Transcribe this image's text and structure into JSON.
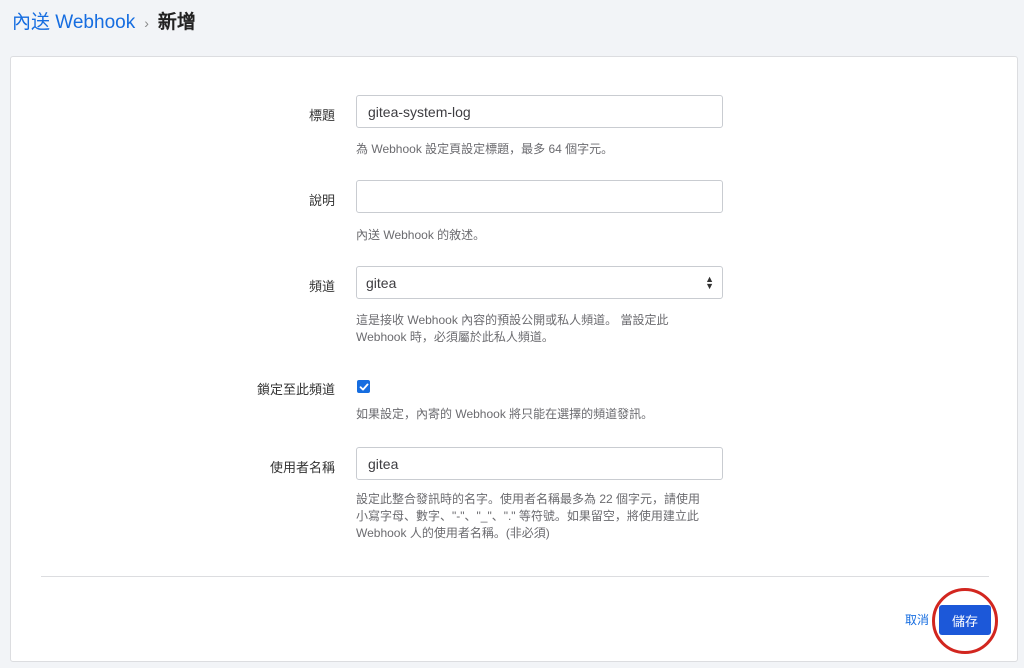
{
  "breadcrumb": {
    "parent": "內送 Webhook",
    "separator": "›",
    "current": "新增"
  },
  "form": {
    "title": {
      "label": "標題",
      "value": "gitea-system-log",
      "help": "為 Webhook 設定頁設定標題，最多 64 個字元。"
    },
    "description": {
      "label": "說明",
      "value": "",
      "help": "內送 Webhook 的敘述。"
    },
    "channel": {
      "label": "頻道",
      "selected": "gitea",
      "help": "這是接收 Webhook 內容的預設公開或私人頻道。 當設定此 Webhook 時，必須屬於此私人頻道。"
    },
    "lock_channel": {
      "label": "鎖定至此頻道",
      "checked": true,
      "help": "如果設定，內寄的 Webhook 將只能在選擇的頻道發訊。"
    },
    "username": {
      "label": "使用者名稱",
      "value": "gitea",
      "help": "設定此整合發訊時的名字。使用者名稱最多為 22 個字元，請使用小寫字母、數字、\"-\"、\"_\"、\".\" 等符號。如果留空，將使用建立此 Webhook 人的使用者名稱。(非必須)"
    }
  },
  "actions": {
    "cancel_label": "取消",
    "save_label": "儲存"
  },
  "colors": {
    "accent": "#166de0",
    "primary_button": "#1c58d9",
    "highlight_ring": "#d2261f"
  }
}
